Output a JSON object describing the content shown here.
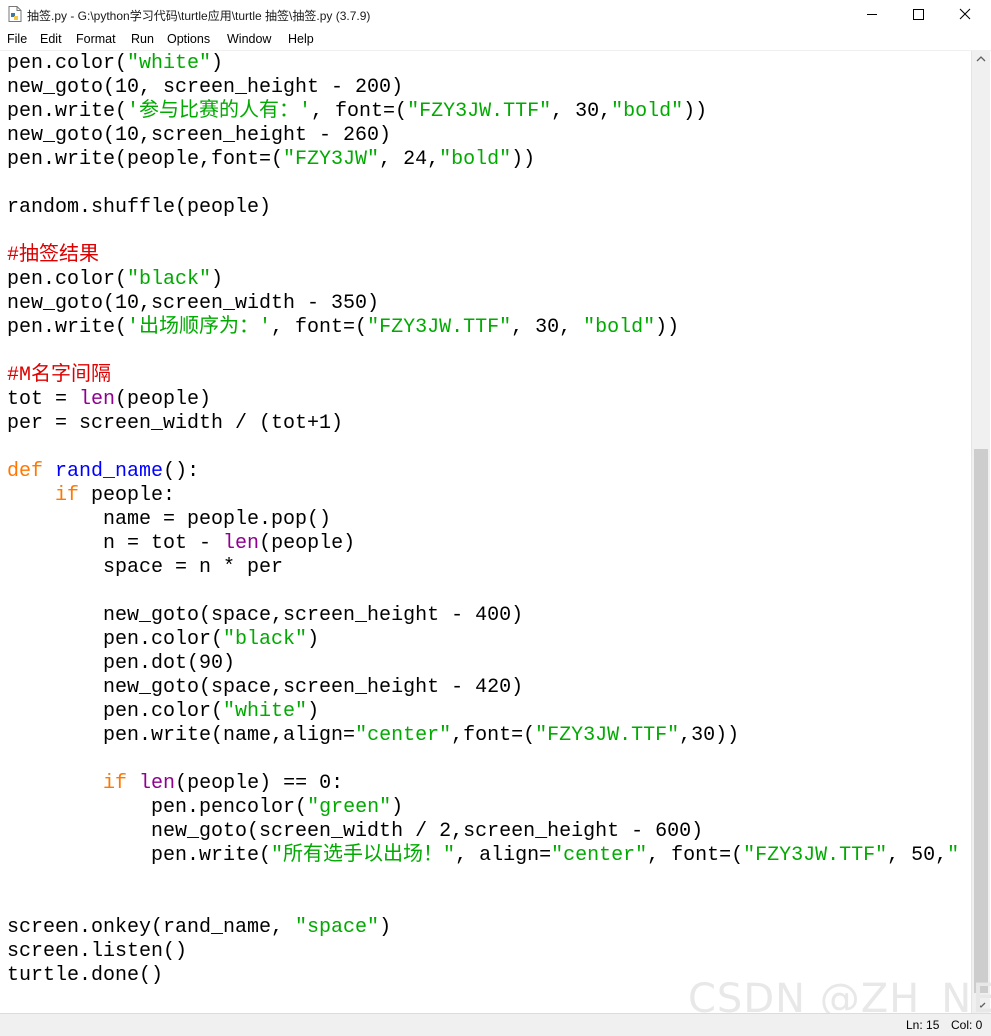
{
  "window": {
    "title": "抽签.py - G:\\python学习代码\\turtle应用\\turtle 抽签\\抽签.py (3.7.9)"
  },
  "menu": [
    "File",
    "Edit",
    "Format",
    "Run",
    "Options",
    "Window",
    "Help"
  ],
  "code_lines": [
    [
      {
        "t": "pen.color("
      },
      {
        "t": "\"white\"",
        "c": "string"
      },
      {
        "t": ")"
      }
    ],
    [
      {
        "t": "new_goto(10, screen_height - 200)"
      }
    ],
    [
      {
        "t": "pen.write("
      },
      {
        "t": "'参与比赛的人有：'",
        "c": "string"
      },
      {
        "t": ", font=("
      },
      {
        "t": "\"FZY3JW.TTF\"",
        "c": "string"
      },
      {
        "t": ", 30,"
      },
      {
        "t": "\"bold\"",
        "c": "string"
      },
      {
        "t": "))"
      }
    ],
    [
      {
        "t": "new_goto(10,screen_height - 260)"
      }
    ],
    [
      {
        "t": "pen.write(people,font=("
      },
      {
        "t": "\"FZY3JW\"",
        "c": "string"
      },
      {
        "t": ", 24,"
      },
      {
        "t": "\"bold\"",
        "c": "string"
      },
      {
        "t": "))"
      }
    ],
    [],
    [
      {
        "t": "random.shuffle(people)"
      }
    ],
    [],
    [
      {
        "t": "#抽签结果",
        "c": "comment"
      }
    ],
    [
      {
        "t": "pen.color("
      },
      {
        "t": "\"black\"",
        "c": "string"
      },
      {
        "t": ")"
      }
    ],
    [
      {
        "t": "new_goto(10,screen_width - 350)"
      }
    ],
    [
      {
        "t": "pen.write("
      },
      {
        "t": "'出场顺序为：'",
        "c": "string"
      },
      {
        "t": ", font=("
      },
      {
        "t": "\"FZY3JW.TTF\"",
        "c": "string"
      },
      {
        "t": ", 30, "
      },
      {
        "t": "\"bold\"",
        "c": "string"
      },
      {
        "t": "))"
      }
    ],
    [],
    [
      {
        "t": "#M名字间隔",
        "c": "comment"
      }
    ],
    [
      {
        "t": "tot = "
      },
      {
        "t": "len",
        "c": "builtin"
      },
      {
        "t": "(people)"
      }
    ],
    [
      {
        "t": "per = screen_width / (tot+1)"
      }
    ],
    [],
    [
      {
        "t": "def",
        "c": "keyword"
      },
      {
        "t": " "
      },
      {
        "t": "rand_name",
        "c": "def"
      },
      {
        "t": "():"
      }
    ],
    [
      {
        "t": "    "
      },
      {
        "t": "if",
        "c": "keyword"
      },
      {
        "t": " people:"
      }
    ],
    [
      {
        "t": "        name = people.pop()"
      }
    ],
    [
      {
        "t": "        n = tot - "
      },
      {
        "t": "len",
        "c": "builtin"
      },
      {
        "t": "(people)"
      }
    ],
    [
      {
        "t": "        space = n * per"
      }
    ],
    [],
    [
      {
        "t": "        new_goto(space,screen_height - 400)"
      }
    ],
    [
      {
        "t": "        pen.color("
      },
      {
        "t": "\"black\"",
        "c": "string"
      },
      {
        "t": ")"
      }
    ],
    [
      {
        "t": "        pen.dot(90)"
      }
    ],
    [
      {
        "t": "        new_goto(space,screen_height - 420)"
      }
    ],
    [
      {
        "t": "        pen.color("
      },
      {
        "t": "\"white\"",
        "c": "string"
      },
      {
        "t": ")"
      }
    ],
    [
      {
        "t": "        pen.write(name,align="
      },
      {
        "t": "\"center\"",
        "c": "string"
      },
      {
        "t": ",font=("
      },
      {
        "t": "\"FZY3JW.TTF\"",
        "c": "string"
      },
      {
        "t": ",30))"
      }
    ],
    [],
    [
      {
        "t": "        "
      },
      {
        "t": "if",
        "c": "keyword"
      },
      {
        "t": " "
      },
      {
        "t": "len",
        "c": "builtin"
      },
      {
        "t": "(people) == 0:"
      }
    ],
    [
      {
        "t": "            pen.pencolor("
      },
      {
        "t": "\"green\"",
        "c": "string"
      },
      {
        "t": ")"
      }
    ],
    [
      {
        "t": "            new_goto(screen_width / 2,screen_height - 600)"
      }
    ],
    [
      {
        "t": "            pen.write("
      },
      {
        "t": "\"所有选手以出场！\"",
        "c": "string"
      },
      {
        "t": ", align="
      },
      {
        "t": "\"center\"",
        "c": "string"
      },
      {
        "t": ", font=("
      },
      {
        "t": "\"FZY3JW.TTF\"",
        "c": "string"
      },
      {
        "t": ", 50,"
      },
      {
        "t": "\"",
        "c": "string"
      }
    ],
    [],
    [],
    [
      {
        "t": "screen.onkey(rand_name, "
      },
      {
        "t": "\"space\"",
        "c": "string"
      },
      {
        "t": ")"
      }
    ],
    [
      {
        "t": "screen.listen()"
      }
    ],
    [
      {
        "t": "turtle.done()"
      }
    ]
  ],
  "syntax_colors": {
    "string": "#00aa00",
    "keyword": "#ff7700",
    "builtin": "#900090",
    "def": "#0000ff",
    "comment": "#dd0000"
  },
  "status": {
    "line": "Ln: 15",
    "col": "Col: 0"
  },
  "watermark": "CSDN @ZH_NE"
}
